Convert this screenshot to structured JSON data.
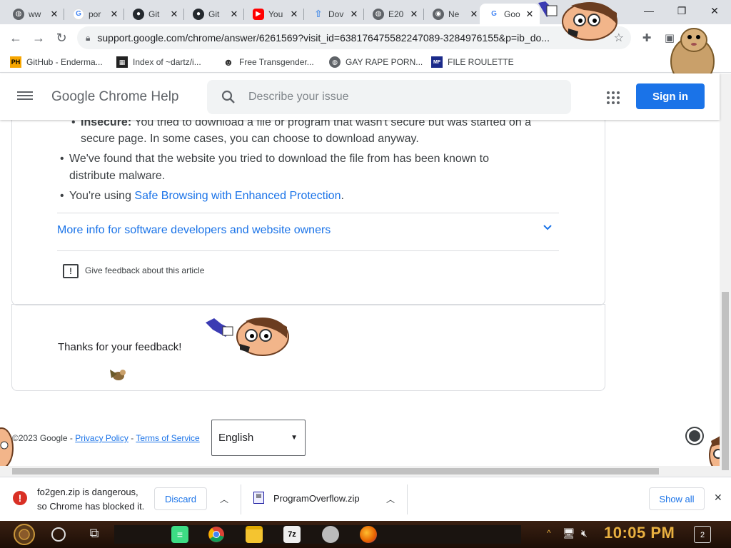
{
  "tabs": [
    {
      "title": "ww",
      "fav": "globe-icon"
    },
    {
      "title": "por",
      "fav": "google-icon"
    },
    {
      "title": "Git",
      "fav": "github-icon"
    },
    {
      "title": "Git",
      "fav": "github-icon"
    },
    {
      "title": "You",
      "fav": "youtube-icon"
    },
    {
      "title": "Dov",
      "fav": "upload-icon"
    },
    {
      "title": "E20",
      "fav": "globe-icon"
    },
    {
      "title": "Ne",
      "fav": "chrome-icon"
    },
    {
      "title": "Goo",
      "fav": "google-icon",
      "active": true
    }
  ],
  "toolbar": {
    "url": "support.google.com/chrome/answer/6261569?visit_id=638176475582247089-3284976155&p=ib_do..."
  },
  "bookmarks": [
    {
      "label": "GitHub - Enderma...",
      "icon": "PH"
    },
    {
      "label": "Index of ~dartz/i...",
      "icon": "grid"
    },
    {
      "label": "Free Transgender...",
      "icon": "mask"
    },
    {
      "label": "GAY RAPE PORN...",
      "icon": "globe"
    },
    {
      "label": "FILE ROULETTE",
      "icon": "MF"
    }
  ],
  "header": {
    "title": "Google Chrome Help",
    "search_placeholder": "Describe your issue",
    "signin": "Sign in"
  },
  "article": {
    "insecure_label": "Insecure:",
    "insecure_line1": " You tried to download a file or program that wasn't secure but was started on a",
    "insecure_line2": "secure page. In some cases, you can choose to download anyway.",
    "malware_line1": "We've found that the website you tried to download the file from has been known to",
    "malware_line2": "distribute malware.",
    "enhanced_prefix": "You're using ",
    "enhanced_link": "Safe Browsing with Enhanced Protection",
    "enhanced_suffix": ".",
    "more_info": "More info for software developers and website owners",
    "feedback": "Give feedback about this article",
    "thanks": "Thanks for your feedback!"
  },
  "footer": {
    "copyright": "©2023 Google - ",
    "privacy": "Privacy Policy",
    "dash": " - ",
    "terms": "Terms of Service",
    "language": "English"
  },
  "downloads": {
    "warning_line1": "fo2gen.zip is dangerous,",
    "warning_line2": "so Chrome has blocked it.",
    "discard": "Discard",
    "file": "ProgramOverflow.zip",
    "show_all": "Show all"
  },
  "taskbar": {
    "time": "10:05 PM",
    "notifications": "2"
  },
  "colors": {
    "accent": "#1a73e8",
    "danger": "#d93025",
    "clock": "#e8b040"
  }
}
